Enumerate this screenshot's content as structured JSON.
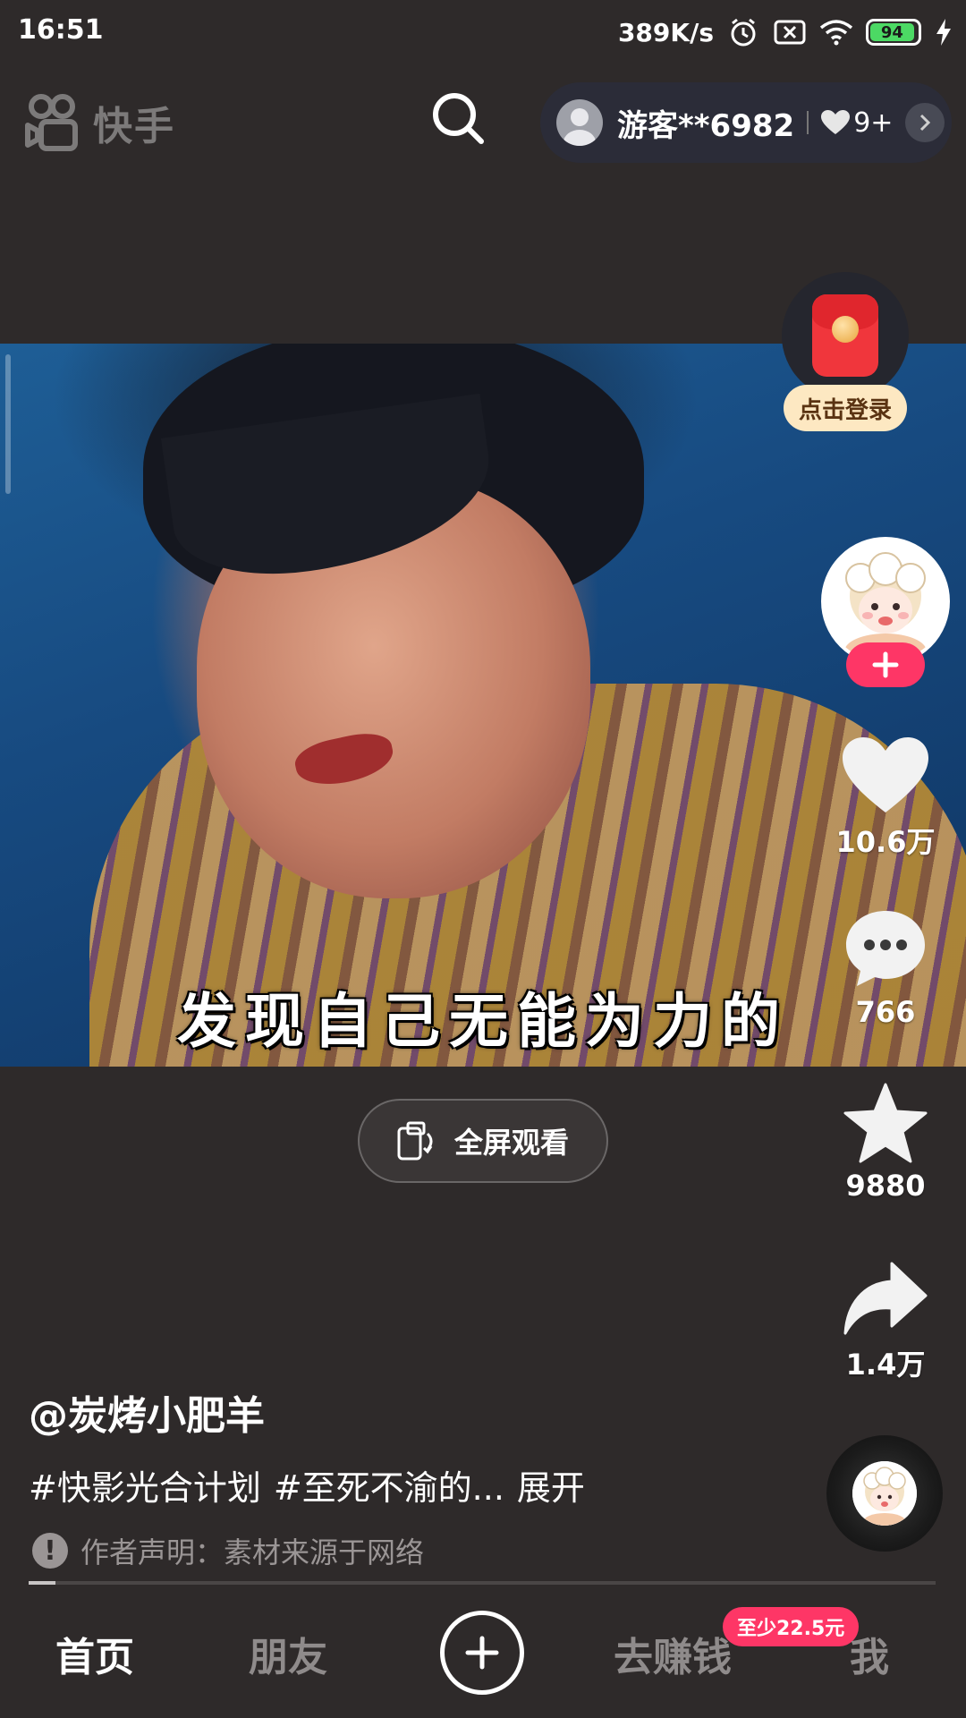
{
  "status_bar": {
    "time": "16:51",
    "net_speed": "389K/s",
    "battery": "94",
    "icons": [
      "alarm-icon",
      "sim-off-icon",
      "wifi-icon",
      "battery-icon",
      "charging-icon"
    ]
  },
  "top_bar": {
    "logo_text": "快手",
    "search_icon": "search-icon",
    "user_name": "游客**6982",
    "likes": "9+"
  },
  "right_rail": {
    "login_label": "点击登录",
    "like_count": "10.6万",
    "comment_count": "766",
    "favorite_count": "9880",
    "share_count": "1.4万"
  },
  "video": {
    "subtitle": "发现自己无能为力的",
    "progress": 0.03
  },
  "fullscreen": {
    "label": "全屏观看"
  },
  "caption": {
    "author": "@炭烤小肥羊",
    "tags": [
      "#快影光合计划",
      "#至死不渝的..."
    ],
    "expand_label": "展开",
    "notice": "作者声明：素材来源于网络"
  },
  "bottom_nav": {
    "home": "首页",
    "friends": "朋友",
    "earn": "去赚钱",
    "earn_badge": "至少22.5元",
    "me": "我"
  },
  "colors": {
    "background": "#2e2a2a",
    "accent": "#fe3666",
    "battery": "#4cd964"
  }
}
